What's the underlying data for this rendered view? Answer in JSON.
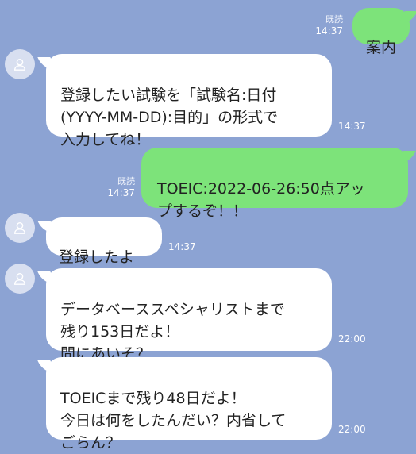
{
  "messages": [
    {
      "id": "m1",
      "side": "out",
      "text": "案内",
      "read": "既読",
      "time": "14:37"
    },
    {
      "id": "m2",
      "side": "in",
      "text": "登録したい試験を「試験名:日付\n(YYYY-MM-DD):目的」の形式で\n入力してね！",
      "time": "14:37"
    },
    {
      "id": "m3",
      "side": "out",
      "text": "TOEIC:2022-06-26:50点アッ\nプするぞ！！",
      "read": "既読",
      "time": "14:37"
    },
    {
      "id": "m4",
      "side": "in",
      "text": "登録したよ",
      "time": "14:37"
    },
    {
      "id": "m5",
      "side": "in",
      "text": "データベーススペシャリストまで\n残り153日だよ！\n間にあいそ？",
      "time": "22:00"
    },
    {
      "id": "m6",
      "side": "in",
      "text": "TOEICまで残り48日だよ！\n今日は何をしたんだい？内省して\nごらん？",
      "time": "22:00"
    }
  ],
  "colors": {
    "background": "#8ca3d3",
    "incoming": "#ffffff",
    "outgoing": "#7de37a"
  },
  "icons": {
    "avatar": "person-icon"
  }
}
